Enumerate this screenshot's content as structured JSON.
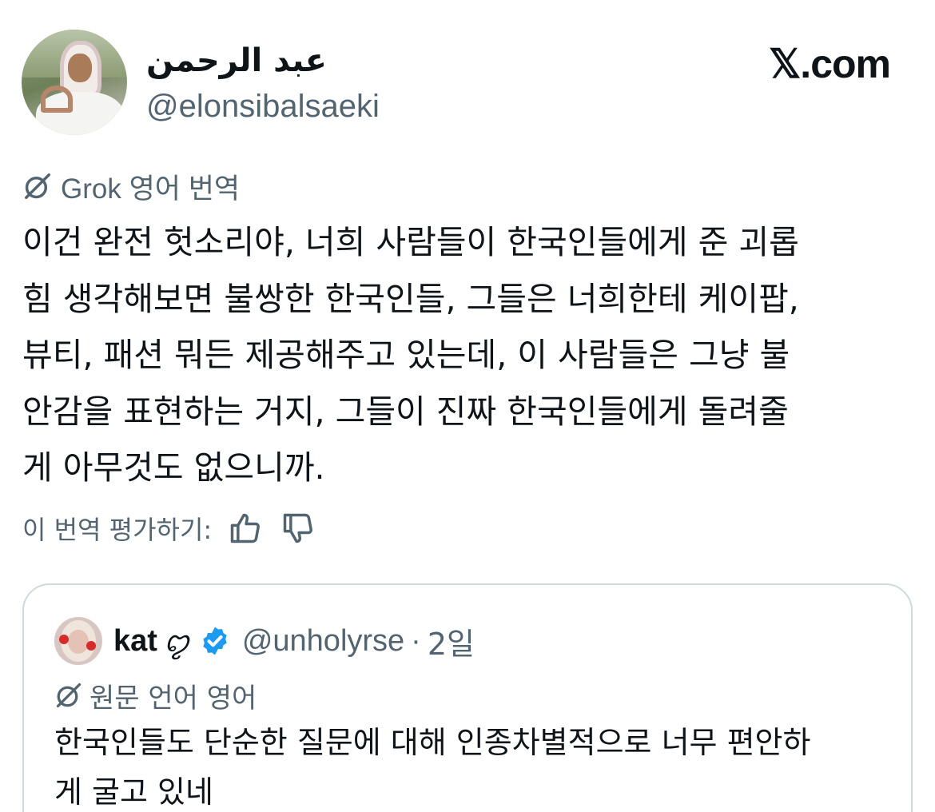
{
  "author": {
    "display_name": "عبد الرحمن",
    "handle": "@elonsibalsaeki"
  },
  "brand": {
    "label": "𝕏.com"
  },
  "translation": {
    "label": "Grok 영어 번역",
    "icon": "grok-icon"
  },
  "post": {
    "lines": [
      "이건 완전 헛소리야, 너희 사람들이 한국인들에게 준 괴롭",
      "힘 생각해보면 불쌍한 한국인들, 그들은 너희한테 케이팝,",
      "뷰티, 패션 뭐든 제공해주고 있는데, 이 사람들은 그냥 불",
      "안감을 표현하는 거지, 그들이 진짜 한국인들에게 돌려줄",
      "게 아무것도 없으니까."
    ]
  },
  "rating": {
    "label": "이 번역 평가하기:",
    "thumbs_up_icon": "thumbs-up-icon",
    "thumbs_down_icon": "thumbs-down-icon"
  },
  "quote": {
    "name": "kat",
    "name_emoji": "ꨄ︎",
    "verified": true,
    "handle": "@unholyrse",
    "separator": "·",
    "time": "2일",
    "lang_label": "원문 언어 영어",
    "lines": [
      "한국인들도 단순한 질문에 대해 인종차별적으로 너무 편안하",
      "게 굴고 있네"
    ]
  },
  "colors": {
    "text": "#0f1419",
    "secondary": "#536471",
    "border": "#cfd9de",
    "verified_blue": "#1d9bf0"
  }
}
